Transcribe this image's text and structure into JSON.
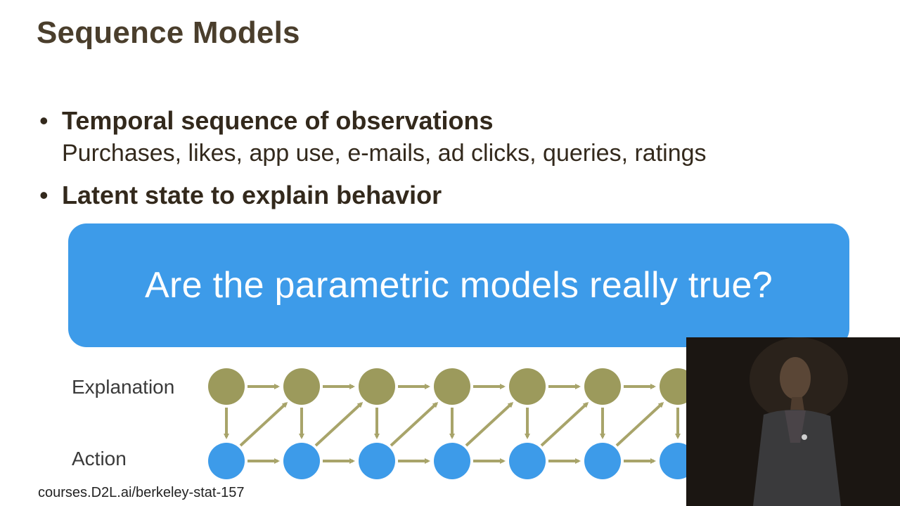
{
  "slide": {
    "title": "Sequence Models",
    "bullets": [
      {
        "head": "Temporal sequence of observations",
        "sub": "Purchases, likes, app use, e-mails, ad clicks, queries, ratings"
      },
      {
        "head": "Latent state to explain behavior"
      }
    ],
    "bullet_glyph": "•",
    "callout": "Are the parametric models really true?",
    "diagram": {
      "top_label": "Explanation",
      "bottom_label": "Action",
      "steps": 7,
      "colors": {
        "latent": "#9c9a5c",
        "observed": "#3d9be9",
        "arrow": "#a8a46a",
        "callout": "#3d9be9"
      }
    },
    "footer": "courses.D2L.ai/berkeley-stat-157"
  }
}
